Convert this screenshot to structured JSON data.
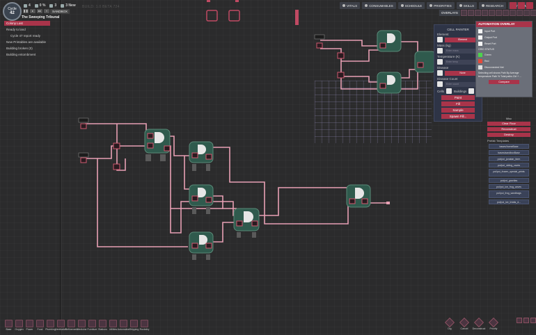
{
  "cycle": {
    "label": "Cycle",
    "number": "42"
  },
  "stats": {
    "duplicants": "4",
    "pct": "0 %",
    "stress": "3",
    "alerts": "3 New"
  },
  "colony_name": "The Sweeping Tribunal",
  "sandbox_label": "SANDBOX",
  "build_label": "BUILD: 1.0 BETA 724",
  "notifications": [
    {
      "text": "Colony Lost",
      "type": "alert"
    },
    {
      "text": "Ready to land",
      "type": "normal"
    },
    {
      "text": "Cycle 47 report ready",
      "type": "sub"
    },
    {
      "text": "New Printables are available",
      "type": "normal"
    },
    {
      "text": "Building broken (0)",
      "type": "normal"
    },
    {
      "text": "Building entombment",
      "type": "normal"
    }
  ],
  "topbar": [
    "VITALS",
    "CONSUMABLES",
    "SCHEDULE",
    "PRIORITIES",
    "SKILLS",
    "RESEARCH",
    "STARMAP"
  ],
  "overlays_label": "OVERLAYS",
  "painter": {
    "title": "CELL PAINTER",
    "element_label": "Element",
    "element_value": "Element",
    "mass_label": "Mass (kg)",
    "mass_value": "Enter mass",
    "temp_label": "Temperature (K)",
    "temp_value": "Enter temp",
    "disease_label": "Disease",
    "disease_value": "None",
    "disease_count_label": "Disease Count",
    "disease_count_value": "Enter count",
    "cells_label": "Cells",
    "buildings_label": "Buildings",
    "buttons": [
      "Paint",
      "Fill",
      "Sample",
      "Spawn Fill..."
    ]
  },
  "automation": {
    "title": "AUTOMATION OVERLAY",
    "legend": [
      {
        "label": "Input Port",
        "color": "#f5f5f5"
      },
      {
        "label": "Output Port",
        "color": "#f5f5f5"
      },
      {
        "label": "Reset Port",
        "color": "#f5f5f5"
      }
    ],
    "states_label": "GRID STATUS",
    "states": [
      {
        "label": "Green",
        "color": "#4dd14d"
      },
      {
        "label": "Red",
        "color": "#e24a3b"
      },
      {
        "label": "Disconnected Net",
        "color": "#e0e0e0"
      }
    ],
    "note": "Selecting cell shows Path By Average temperature Path % Total paths Ctrl + ...",
    "compare_label": "Compare"
  },
  "tools": {
    "misc_label": "Misc",
    "misc_buttons": [
      "Clear Floor",
      "Reconstruct",
      "Destroy"
    ],
    "prefab_label": "Prefab Templates",
    "prefabs": [
      "bases/homeBase",
      "bases/sandboxBase",
      "poi/poi_jonatan_farm",
      "poi/poi_skiing_caves",
      "poi/poi_frozen_special_prints",
      "poi/poi_gravitas",
      "poi/poi_ice_frog_caves",
      "poi/poi_frog_sandbags",
      "poi/poi_ice_treats_d..."
    ]
  },
  "bottom_tools": [
    "Base",
    "Oxygen",
    "Power",
    "Food",
    "Plumbing",
    "Ventilation",
    "Refinement",
    "Medicine",
    "Furniture",
    "Stations",
    "Utilities",
    "Automation",
    "Shipping",
    "Rocketry"
  ],
  "bottom_right_tools": [
    "Dig",
    "Cancel",
    "Deconstruct",
    "Priority"
  ]
}
